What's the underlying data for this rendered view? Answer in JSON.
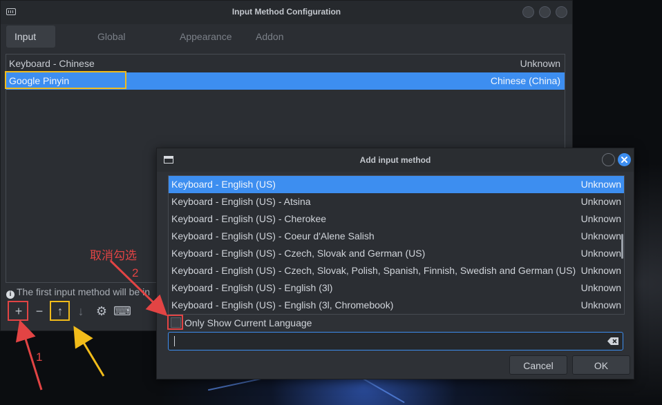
{
  "main_window": {
    "title": "Input Method Configuration",
    "tabs": [
      {
        "label": "Input Method",
        "active": true
      },
      {
        "label": "Global Config",
        "active": false
      },
      {
        "label": "Appearance",
        "active": false
      },
      {
        "label": "Addon",
        "active": false
      }
    ],
    "input_methods": [
      {
        "name": "Keyboard - Chinese",
        "language": "Unknown",
        "selected": false
      },
      {
        "name": "Google Pinyin",
        "language": "Chinese (China)",
        "selected": true
      }
    ],
    "info_text": "The first input method will be in",
    "toolbar": [
      {
        "icon": "plus-icon",
        "glyph": "+"
      },
      {
        "icon": "minus-icon",
        "glyph": "−"
      },
      {
        "icon": "arrow-up-icon",
        "glyph": "↑"
      },
      {
        "icon": "arrow-down-icon",
        "glyph": "↓"
      },
      {
        "icon": "gear-icon",
        "glyph": "⚙"
      },
      {
        "icon": "keyboard-icon",
        "glyph": "⌨"
      }
    ]
  },
  "dialog": {
    "title": "Add input method",
    "items": [
      {
        "name": "Keyboard - English (US)",
        "language": "Unknown",
        "selected": true
      },
      {
        "name": "Keyboard - English (US) - Atsina",
        "language": "Unknown",
        "selected": false
      },
      {
        "name": "Keyboard - English (US) - Cherokee",
        "language": "Unknown",
        "selected": false
      },
      {
        "name": "Keyboard - English (US) - Coeur d'Alene Salish",
        "language": "Unknown",
        "selected": false
      },
      {
        "name": "Keyboard - English (US) - Czech, Slovak and German (US)",
        "language": "Unknown",
        "selected": false
      },
      {
        "name": "Keyboard - English (US) - Czech, Slovak, Polish, Spanish, Finnish, Swedish and German (US)",
        "language": "Unknown",
        "selected": false
      },
      {
        "name": "Keyboard - English (US) - English (3l)",
        "language": "Unknown",
        "selected": false
      },
      {
        "name": "Keyboard - English (US) - English (3l, Chromebook)",
        "language": "Unknown",
        "selected": false
      }
    ],
    "only_show_current_language": {
      "label": "Only Show Current Language",
      "checked": false
    },
    "search": {
      "value": "",
      "placeholder": ""
    },
    "cancel_label": "Cancel",
    "ok_label": "OK"
  },
  "annotations": {
    "label_1": "1",
    "label_2": "2",
    "uncheck_note": "取消勾选",
    "red_color": "#e24444",
    "yellow_color": "#f2bc1a"
  },
  "colors": {
    "selection": "#3d8ef0",
    "window_bg": "#2b2e33",
    "close_button": "#3d8ef0"
  }
}
